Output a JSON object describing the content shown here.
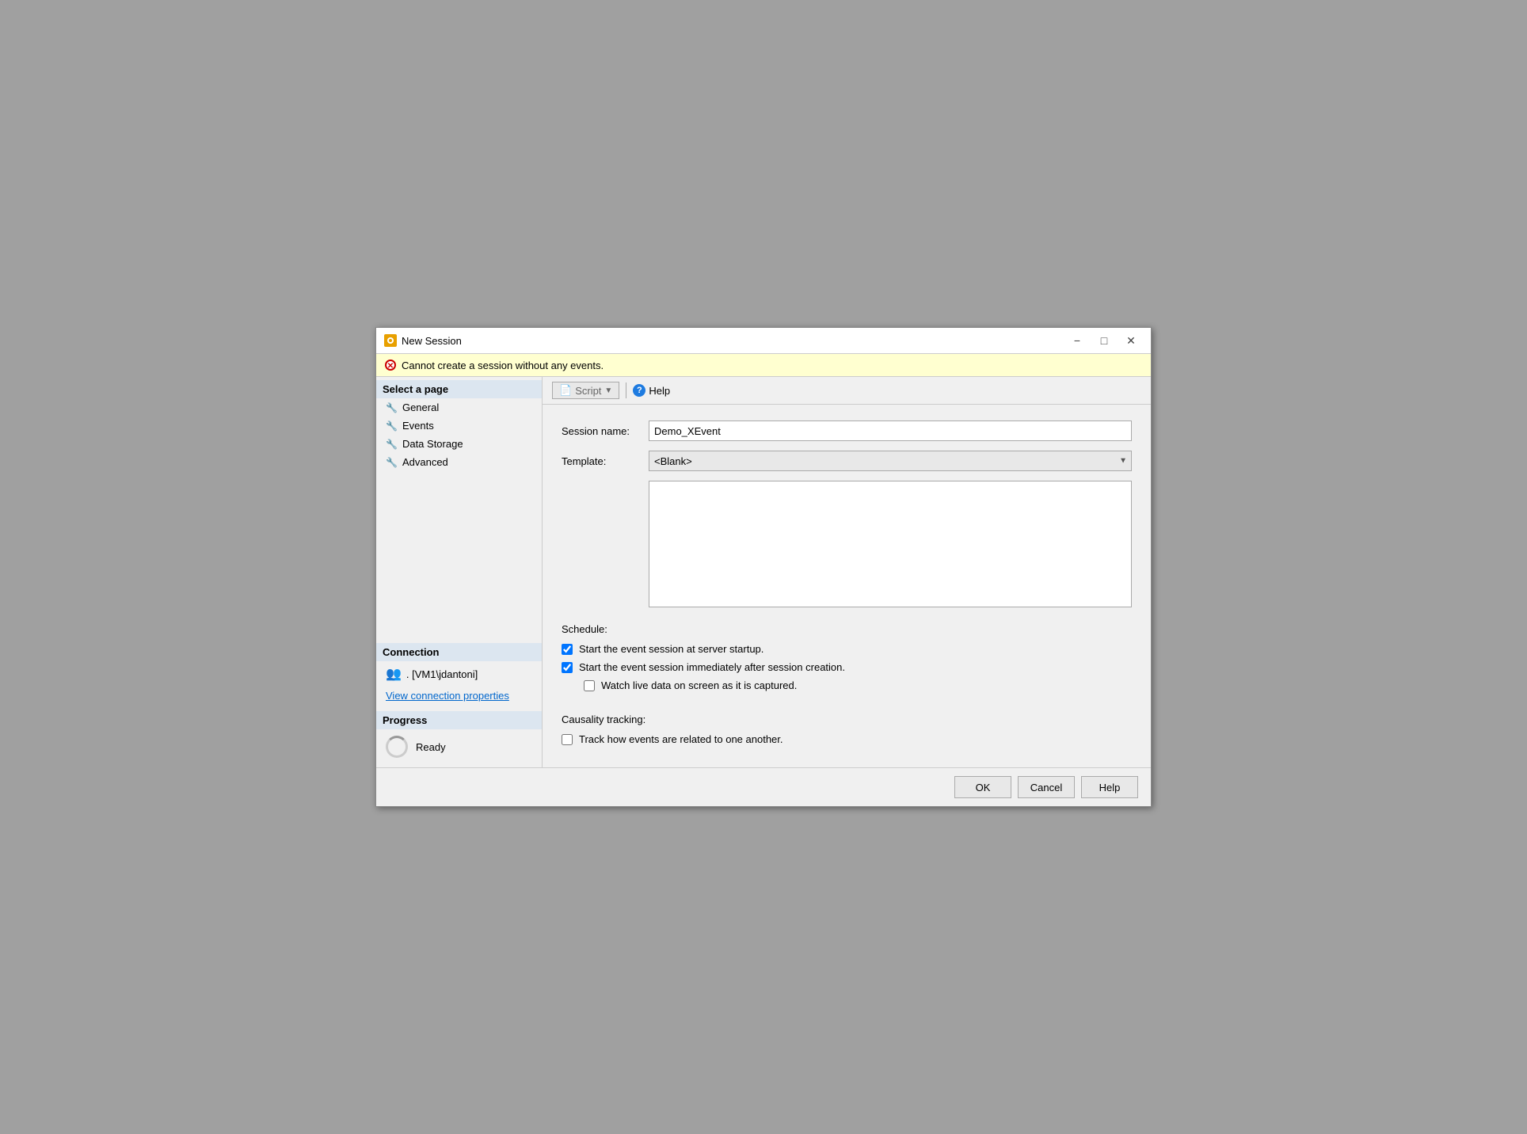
{
  "window": {
    "title": "New Session"
  },
  "error_bar": {
    "message": "Cannot create a session without any events."
  },
  "sidebar": {
    "select_page_label": "Select a page",
    "items": [
      {
        "id": "general",
        "label": "General"
      },
      {
        "id": "events",
        "label": "Events"
      },
      {
        "id": "data-storage",
        "label": "Data Storage"
      },
      {
        "id": "advanced",
        "label": "Advanced"
      }
    ],
    "connection_label": "Connection",
    "connection_server": ". [VM1\\jdantoni]",
    "view_connection_link": "View connection properties",
    "progress_label": "Progress",
    "progress_status": "Ready"
  },
  "toolbar": {
    "script_label": "Script",
    "help_label": "Help"
  },
  "form": {
    "session_name_label": "Session name:",
    "session_name_value": "Demo_XEvent",
    "template_label": "Template:",
    "template_value": "<Blank>",
    "template_options": [
      "<Blank>"
    ],
    "schedule_label": "Schedule:",
    "checkbox_startup_label": "Start the event session at server startup.",
    "checkbox_startup_checked": true,
    "checkbox_immediate_label": "Start the event session immediately after session creation.",
    "checkbox_immediate_checked": true,
    "checkbox_watch_label": "Watch live data on screen as it is captured.",
    "checkbox_watch_checked": false,
    "causality_label": "Causality tracking:",
    "checkbox_track_label": "Track how events are related to one another.",
    "checkbox_track_checked": false
  },
  "footer": {
    "ok_label": "OK",
    "cancel_label": "Cancel",
    "help_label": "Help"
  }
}
